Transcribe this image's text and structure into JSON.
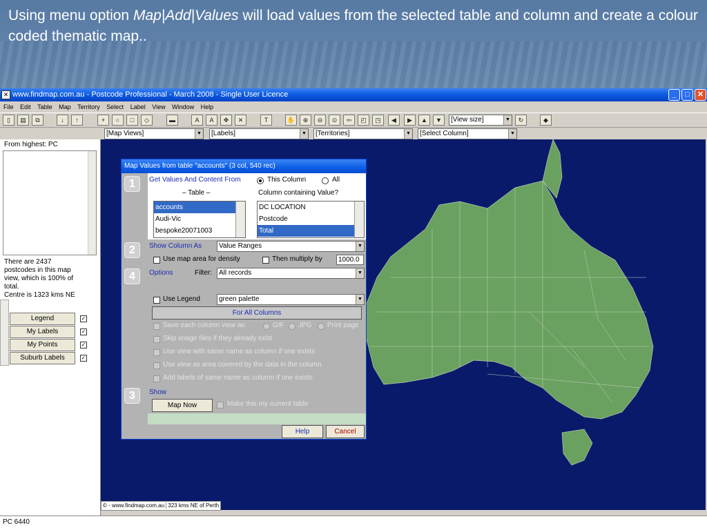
{
  "slide": {
    "heading_pre": "Using menu option ",
    "heading_italic": "Map|Add|Values",
    "heading_post": " will load values from the selected table and column and create a colour coded thematic map.."
  },
  "window": {
    "title": "www.findmap.com.au - Postcode Professional - March 2008 - Single User Licence",
    "menu": [
      "File",
      "Edit",
      "Table",
      "Map",
      "Territory",
      "Select",
      "Label",
      "View",
      "Window",
      "Help"
    ]
  },
  "toolbar": {
    "view_size": "[View size]",
    "map_views": "[Map Views]",
    "labels": "[Labels]",
    "territories": "[Territories]",
    "select_column": "[Select Column]"
  },
  "left_pane": {
    "label": "From highest: PC",
    "info_1": "There are 2437",
    "info_2": "postcodes in this map",
    "info_3": "view, which is 100% of",
    "info_4": "total.",
    "info_5": "Centre is 1323 kms NE",
    "buttons": [
      "Legend",
      "My Labels",
      "My Points",
      "Suburb Labels"
    ]
  },
  "map": {
    "footer_left": "© - www.findmap.com.au",
    "footer_right": "323 kms NE of Perth",
    "land_color": "#6aa060",
    "sea_color": "#0a1a6a"
  },
  "status": {
    "text": "PC 6440"
  },
  "dialog": {
    "title": "Map Values from table \"accounts\"  (3 col, 540 rec)",
    "step1": "1",
    "step2": "2",
    "step3": "3",
    "step4": "4",
    "get_values": "Get Values And Content From",
    "this_column": "This Column",
    "all": "All",
    "table_header": "– Table –",
    "column_header": "Column containing Value?",
    "tables": [
      "accounts",
      "Audi-Vic",
      "bespoke20071003"
    ],
    "columns": [
      "DC LOCATION",
      "Postcode",
      "Total"
    ],
    "show_column_as": "Show Column As",
    "show_value": "Value Ranges",
    "density": "Use map area for density",
    "multiply": "Then multiply by",
    "multiply_value": "1000.0",
    "options": "Options",
    "filter": "Filter:",
    "filter_value": "All records",
    "use_legend": "Use Legend",
    "palette": "green palette",
    "for_all": "For All Columns",
    "save_view": "Save each column view as:",
    "gif": "GIF",
    "jpg": "JPG",
    "print_page": "Print page",
    "skip": "Skip image files if they already exist",
    "use_view": "Use view with same name as column if one exists",
    "use_area": "Use view as area covered by the data in the column",
    "add_labels": "Add labels of same name as column if one exists",
    "show": "Show",
    "map_now": "Map Now",
    "make_current": "Make this my current table",
    "help": "Help",
    "cancel": "Cancel"
  }
}
